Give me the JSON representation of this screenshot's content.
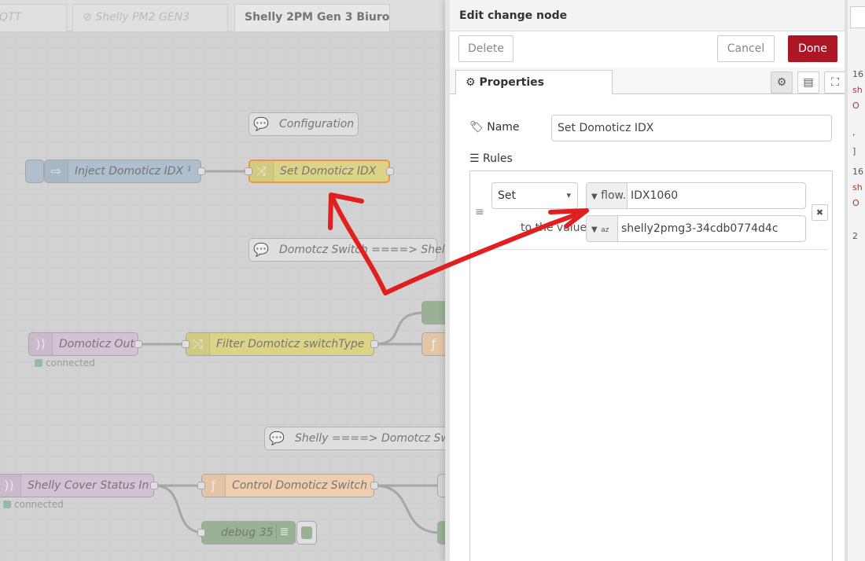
{
  "workspace": {
    "tabs": [
      "QTT",
      "Shelly PM2 GEN3",
      "Shelly 2PM Gen 3 Biuro"
    ],
    "disabled_icon": "⊘",
    "nodes": {
      "configuration": "Configuration",
      "inject": "Inject Domoticz IDX",
      "inject_suffix": "¹",
      "set_idx": "Set Domoticz IDX",
      "comment_switch": "Domotcz Switch ====> Shelly",
      "domoticz_out": "Domoticz Out",
      "filter": "Filter Domoticz switchType",
      "comment_shelly": "Shelly ====> Domotcz Switch",
      "cover_status": "Shelly Cover Status In",
      "control": "Control Domoticz Switch",
      "debug": "debug 35",
      "func_symbol": "ƒ"
    },
    "status_connected": "connected"
  },
  "tray": {
    "title": "Edit change node",
    "delete": "Delete",
    "cancel": "Cancel",
    "done": "Done",
    "tab_properties": "Properties",
    "name_label": "Name",
    "name_value": "Set Domoticz IDX",
    "rules_label": "Rules",
    "rule": {
      "action": "Set",
      "target_type": "flow.",
      "target_value": "IDX1060",
      "to_label": "to the value",
      "value_type_icon": "az",
      "value": "shelly2pmg3-34cdb0774d4c"
    }
  },
  "sidebar": {
    "lines": [
      {
        "text": "16",
        "color": "#555"
      },
      {
        "text": "sh",
        "color": "#a33"
      },
      {
        "text": "O",
        "color": "#a33"
      },
      {
        "text": ",",
        "color": "#555"
      },
      {
        "text": "]",
        "color": "#555"
      },
      {
        "text": "16",
        "color": "#555"
      },
      {
        "text": "sh",
        "color": "#a33"
      },
      {
        "text": "O",
        "color": "#a33"
      },
      {
        "text": "2",
        "color": "#555"
      }
    ]
  },
  "colors": {
    "done": "#ad1625",
    "inject": "#a6bbcf",
    "change": "#e2d96e",
    "function": "#fdd0a2",
    "domoticz": "#d8bfd8",
    "debug": "#87a980",
    "annotation_arrow": "#e02020"
  }
}
